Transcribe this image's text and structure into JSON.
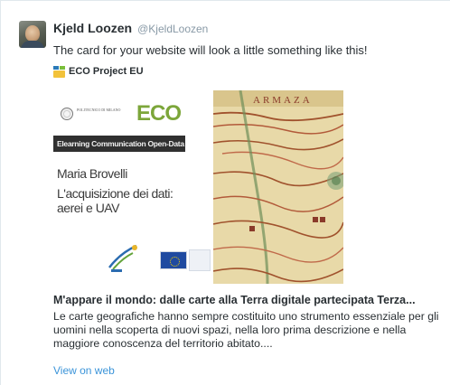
{
  "tweet": {
    "display_name": "Kjeld Loozen",
    "handle": "@KjeldLoozen",
    "text": "The card for your website will look a little something like this!"
  },
  "page": {
    "name": "ECO Project EU"
  },
  "hero": {
    "institution": "POLITECNICO DI MILANO",
    "brand": "ECO",
    "band": "Elearning Communication Open-Data",
    "author": "Maria Brovelli",
    "topic_line_1": "L'acquisizione dei dati:",
    "topic_line_2": "aerei e UAV",
    "map_label": "ARMAZA"
  },
  "card": {
    "title": "M'appare il mondo: dalle carte alla Terra digitale partecipata Terza...",
    "description_lines": [
      "Le carte geografiche hanno sempre costituito uno strumento essenziale per gli",
      "uomini nella scoperta di nuovi spazi, nella loro prima descrizione e nella",
      "maggiore conoscenza del territorio abitato...."
    ],
    "link_label": "View on web"
  },
  "colors": {
    "text": "#292f33",
    "muted": "#8899a6",
    "link": "#3b94d9",
    "border": "#e1e8ed"
  }
}
